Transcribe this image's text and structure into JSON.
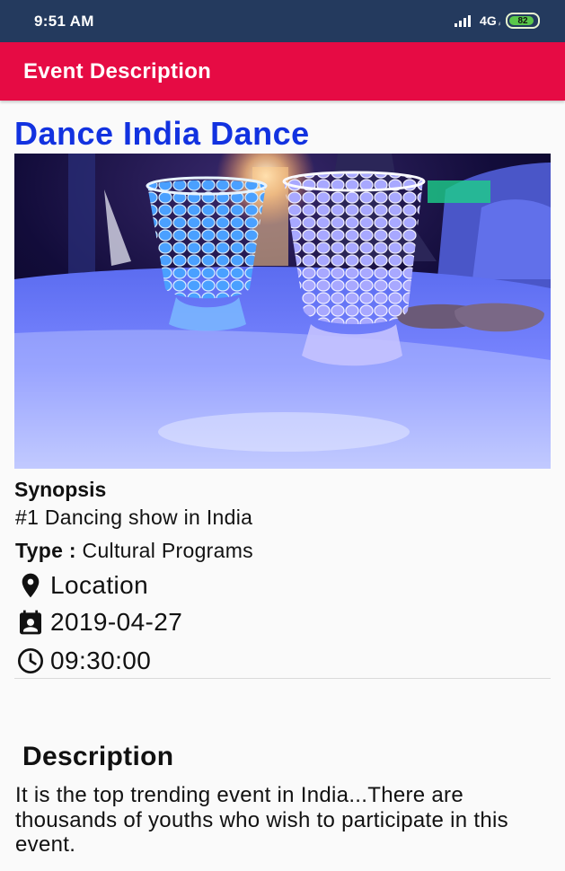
{
  "status_bar": {
    "time": "9:51 AM",
    "network": "4G",
    "network_sub": "ᵢₗ",
    "battery": "82"
  },
  "app_bar": {
    "title": "Event Description"
  },
  "event": {
    "title": "Dance India Dance",
    "synopsis_heading": "Synopsis",
    "synopsis": "#1 Dancing show in India",
    "type_label": "Type :",
    "type_value": "Cultural Programs",
    "location": "Location",
    "date": "2019-04-27",
    "time": "09:30:00",
    "description_heading": "Description",
    "description": "It is the top trending event in India...There are thousands of youths who wish to participate in this event."
  },
  "colors": {
    "status_bar": "#243a5e",
    "app_bar": "#e60b44",
    "title": "#1232e0"
  },
  "icons": {
    "location": "location-pin-icon",
    "date": "calendar-icon",
    "time": "clock-icon"
  }
}
